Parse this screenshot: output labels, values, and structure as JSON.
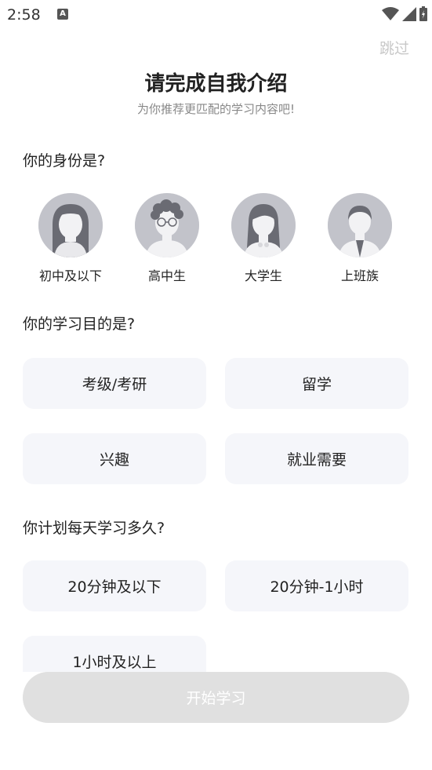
{
  "status": {
    "time": "2:58",
    "notif_icon": "A"
  },
  "header": {
    "skip_label": "跳过"
  },
  "intro": {
    "title": "请完成自我介绍",
    "subtitle": "为你推荐更匹配的学习内容吧!"
  },
  "identity": {
    "question": "你的身份是?",
    "options": [
      {
        "label": "初中及以下",
        "icon": "girl-avatar-icon"
      },
      {
        "label": "高中生",
        "icon": "glasses-boy-avatar-icon"
      },
      {
        "label": "大学生",
        "icon": "college-girl-avatar-icon"
      },
      {
        "label": "上班族",
        "icon": "office-man-avatar-icon"
      }
    ]
  },
  "goal": {
    "question": "你的学习目的是?",
    "options": [
      "考级/考研",
      "留学",
      "兴趣",
      "就业需要"
    ]
  },
  "time": {
    "question": "你计划每天学习多久?",
    "options": [
      "20分钟及以下",
      "20分钟-1小时",
      "1小时及以上"
    ]
  },
  "footer": {
    "start_label": "开始学习"
  },
  "colors": {
    "option_bg": "#f5f6fa",
    "button_disabled": "#e0e0e0",
    "avatar_bg": "#e3e3e7"
  }
}
